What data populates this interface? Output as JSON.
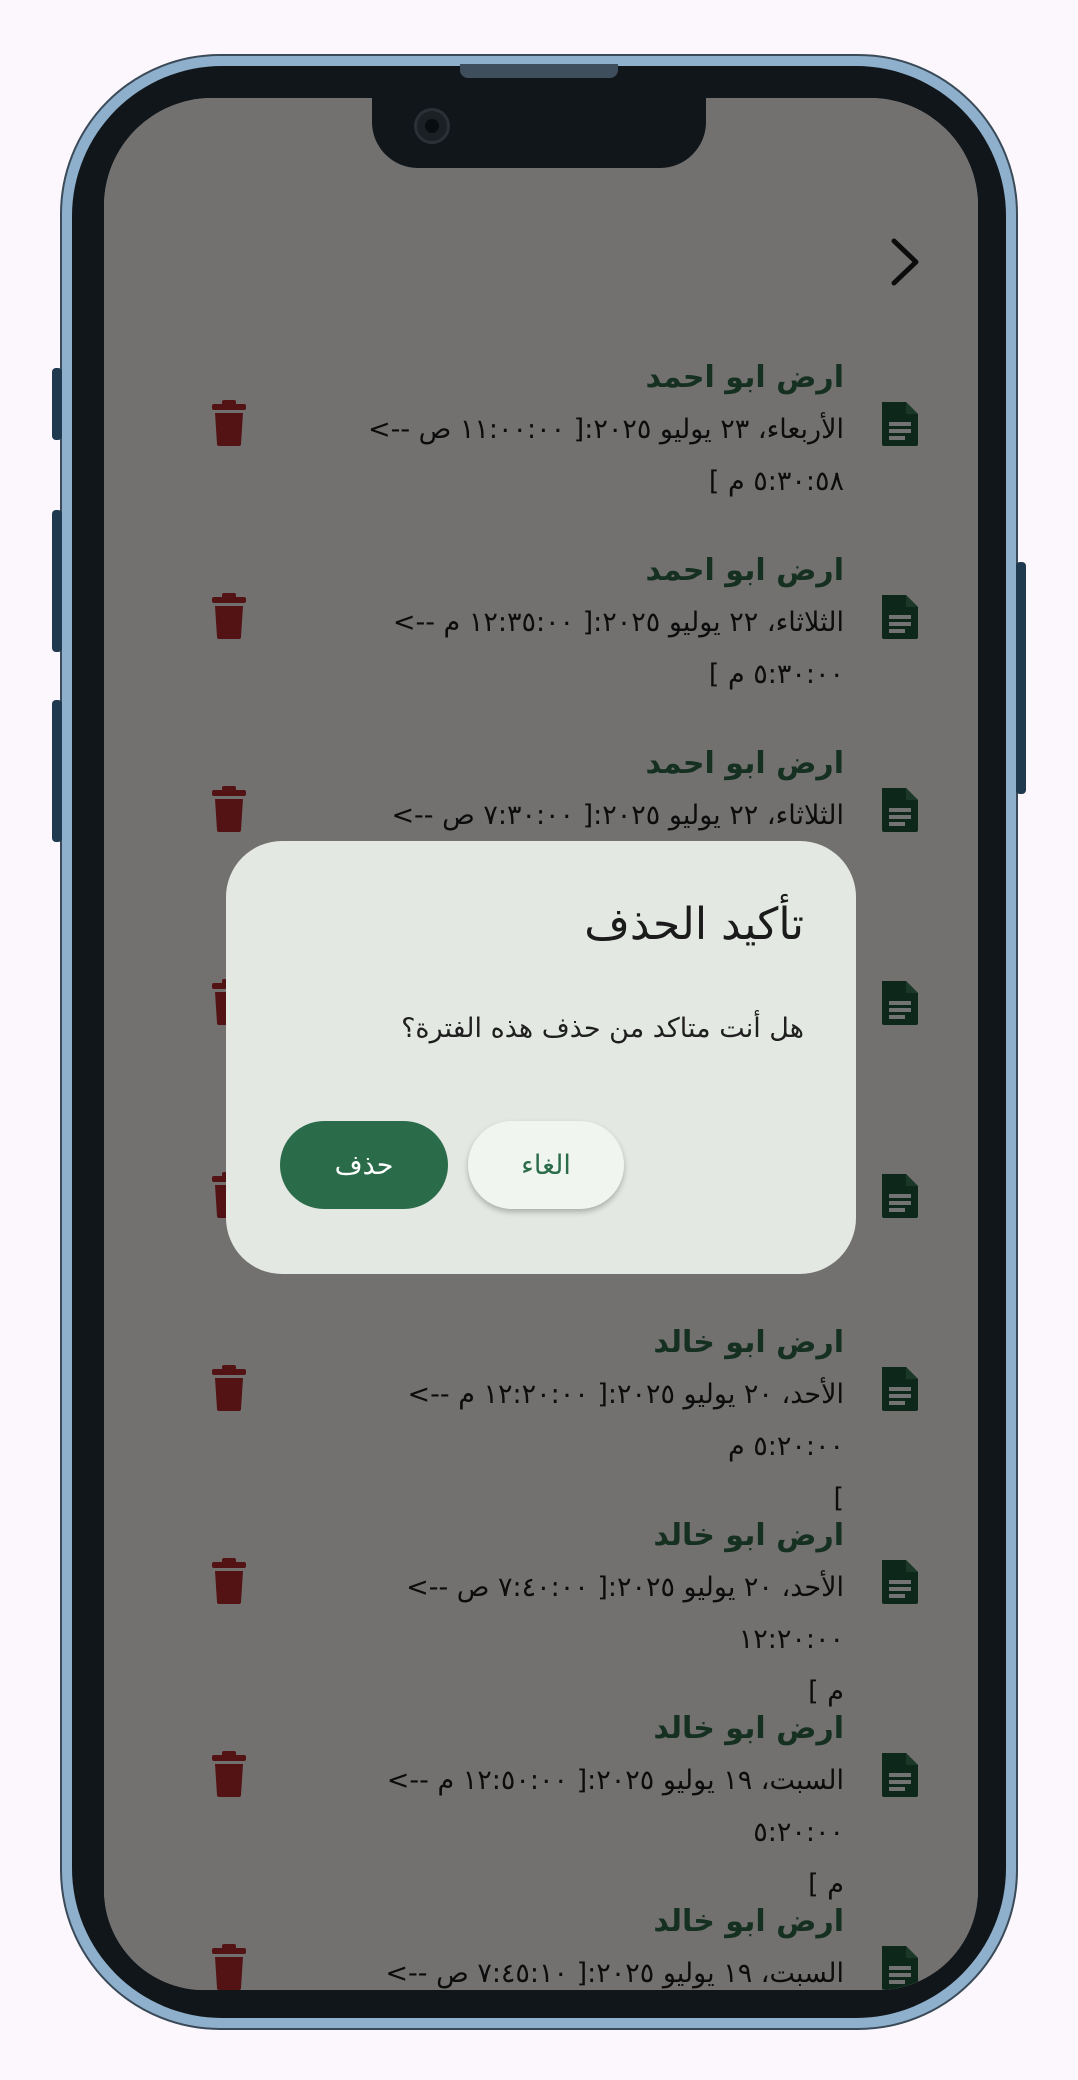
{
  "colors": {
    "accent": "#2a6b4a",
    "title_green": "#2f6b4a",
    "icon_green": "#1e5a3a",
    "trash_red": "#b8292a",
    "dialog_bg": "#e4e8e2"
  },
  "app_bar": {
    "back_icon": "chevron-right-icon"
  },
  "items": [
    {
      "title": "ارض ابو احمد",
      "line1": "الأربعاء، ٢٣ يوليو ٢٠٢٥:[ ١١:٠٠:٠٠ ص -->",
      "line2": "٥:٣٠:٥٨ م ]"
    },
    {
      "title": "ارض ابو احمد",
      "line1": "الثلاثاء، ٢٢ يوليو ٢٠٢٥:[ ١٢:٣٥:٠٠ م -->",
      "line2": "٥:٣٠:٠٠ م ]"
    },
    {
      "title": "ارض ابو احمد",
      "line1": "الثلاثاء، ٢٢ يوليو ٢٠٢٥:[ ٧:٣٠:٠٠ ص -->",
      "line2": ""
    },
    {
      "title": "",
      "line1": "",
      "line2": ""
    },
    {
      "title": "",
      "line1": "",
      "line2": "]"
    },
    {
      "title": "ارض ابو خالد",
      "line1": "الأحد، ٢٠ يوليو ٢٠٢٥:[ ١٢:٢٠:٠٠ م --> ٥:٢٠:٠٠ م",
      "line2": "]"
    },
    {
      "title": "ارض ابو خالد",
      "line1": "الأحد، ٢٠ يوليو ٢٠٢٥:[ ٧:٤٠:٠٠ ص --> ١٢:٢٠:٠٠",
      "line2": "م ]"
    },
    {
      "title": "ارض ابو خالد",
      "line1": "السبت، ١٩ يوليو ٢٠٢٥:[ ١٢:٥٠:٠٠ م --> ٥:٢٠:٠٠",
      "line2": "م ]"
    },
    {
      "title": "ارض ابو خالد",
      "line1": "السبت، ١٩ يوليو ٢٠٢٥:[ ٧:٤٥:١٠ ص -->",
      "line2": ""
    }
  ],
  "dialog": {
    "title": "تأكيد الحذف",
    "message": "هل أنت متاكد من حذف هذه الفترة؟",
    "delete_label": "حذف",
    "cancel_label": "الغاء"
  }
}
